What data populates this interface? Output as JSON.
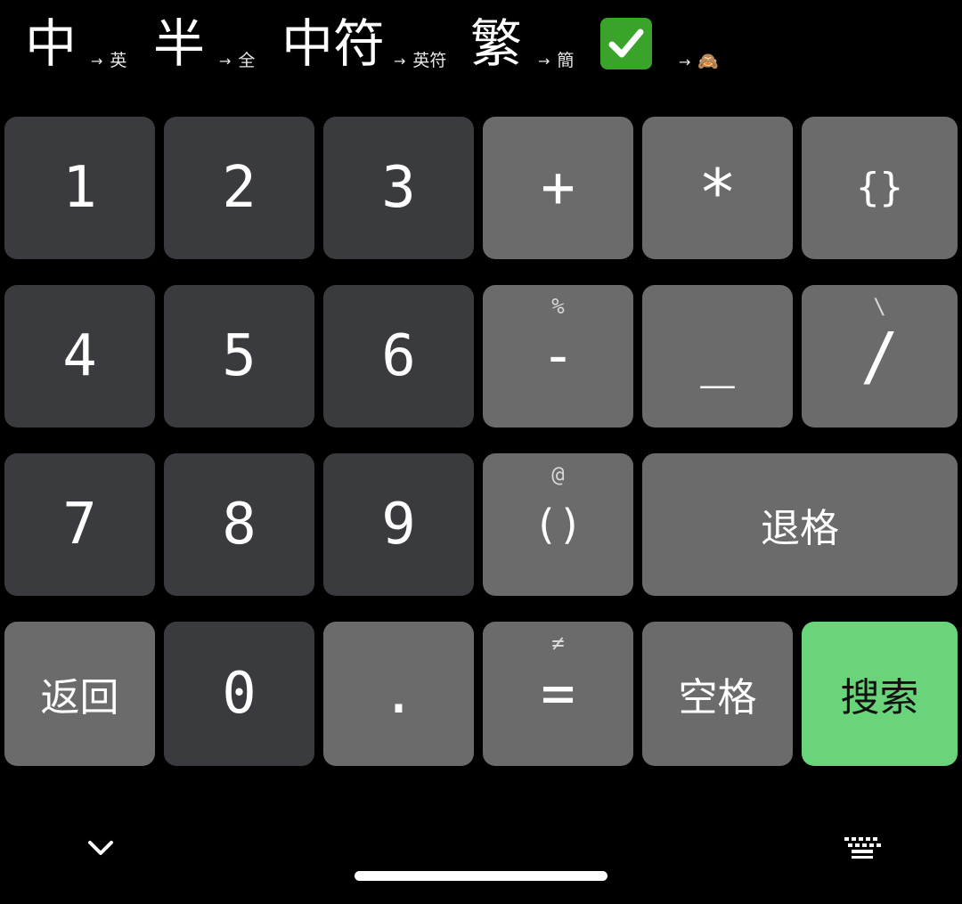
{
  "toolbar": {
    "items": [
      {
        "main": "中",
        "arrow": "→",
        "sub": "英"
      },
      {
        "main": "半",
        "arrow": "→",
        "sub": "全"
      },
      {
        "main": "中符",
        "arrow": "→",
        "sub": "英符"
      },
      {
        "main": "繁",
        "arrow": "→",
        "sub": "簡"
      },
      {
        "main": "✅",
        "arrow": "→",
        "sub": "🙈"
      }
    ]
  },
  "keys": {
    "k1": {
      "label": "1"
    },
    "k2": {
      "label": "2"
    },
    "k3": {
      "label": "3"
    },
    "plus": {
      "label": "+"
    },
    "star": {
      "label": "*"
    },
    "braces": {
      "label": "{}"
    },
    "k4": {
      "label": "4"
    },
    "k5": {
      "label": "5"
    },
    "k6": {
      "label": "6"
    },
    "minus": {
      "label": "-",
      "hint": "%"
    },
    "underscore": {
      "label": "_"
    },
    "slash": {
      "label": "/",
      "hint": "\\"
    },
    "k7": {
      "label": "7"
    },
    "k8": {
      "label": "8"
    },
    "k9": {
      "label": "9"
    },
    "parens": {
      "label": "()",
      "hint": "@"
    },
    "backspace": {
      "label": "退格"
    },
    "back": {
      "label": "返回"
    },
    "k0": {
      "label": "0"
    },
    "dot": {
      "label": "."
    },
    "equals": {
      "label": "=",
      "hint": "≠"
    },
    "space": {
      "label": "空格"
    },
    "search": {
      "label": "搜索"
    }
  },
  "colors": {
    "background": "#000000",
    "key_dark": "#3a3b3f",
    "key_light": "#6b6b6b",
    "key_accent": "#6ad47a"
  },
  "icons": {
    "collapse": "chevron-down-icon",
    "keyboard_switch": "keyboard-icon"
  }
}
